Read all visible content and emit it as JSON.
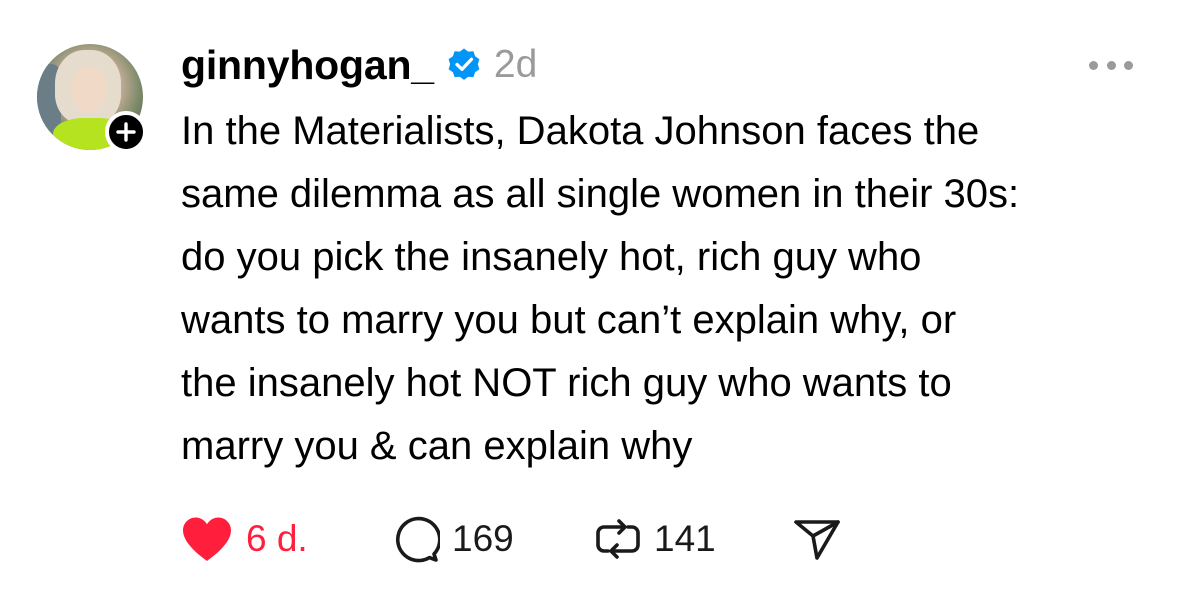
{
  "post": {
    "username": "ginnyhogan_",
    "verified": true,
    "timestamp": "2d",
    "body_lines": [
      "In the Materialists, Dakota Johnson faces the",
      "same dilemma as all single women in their 30s:",
      "do you pick the insanely hot, rich guy who",
      "wants to marry you but can’t explain why, or",
      "the insanely hot NOT rich guy who wants to",
      "marry you & can explain why"
    ],
    "actions": {
      "like_count": "6 d.",
      "liked": true,
      "reply_count": "169",
      "repost_count": "141"
    }
  },
  "icons": {
    "avatar": "avatar-photo",
    "follow": "plus-icon",
    "verified": "verified-check-icon",
    "more": "more-dots-icon",
    "like": "heart-icon",
    "reply": "speech-bubble-icon",
    "repost": "repost-icon",
    "share": "send-icon"
  },
  "colors": {
    "like_active": "#ff1f3d",
    "verified_blue": "#0095f6",
    "muted_gray": "#9a9a9a"
  }
}
